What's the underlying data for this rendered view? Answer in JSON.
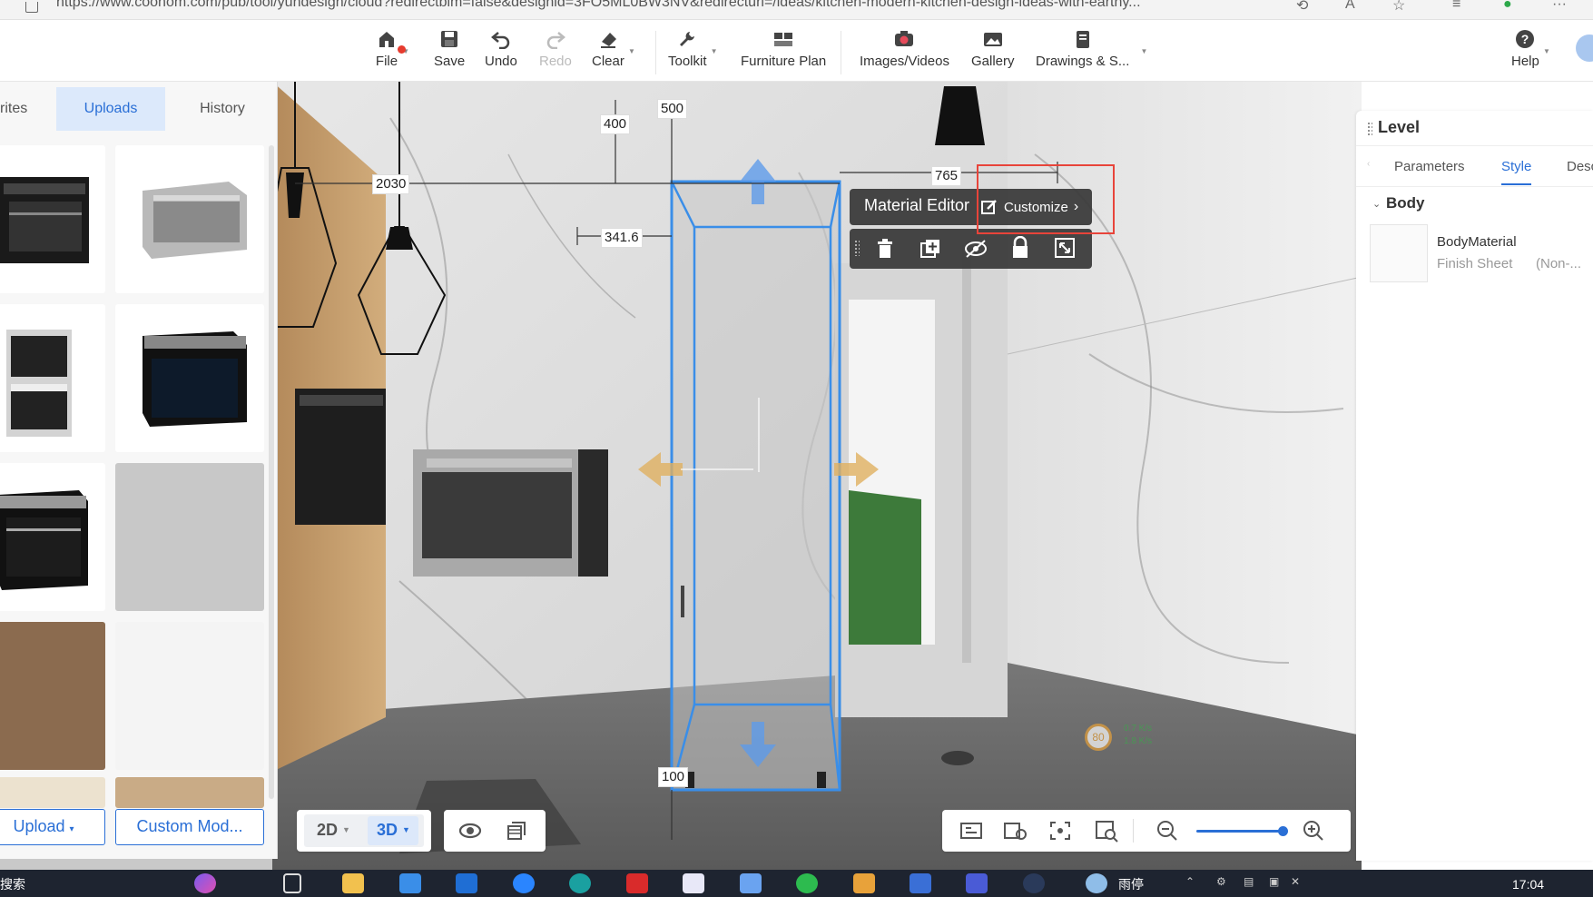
{
  "browser": {
    "url": "https://www.coohom.com/pub/tool/yundesign/cloud?redirectbim=false&designid=3FO5ML0BW3NV&redirecturl=/ideas/kitchen-modern-kitchen-design-ideas-with-earthy..."
  },
  "toolbar": {
    "file": "File",
    "save": "Save",
    "undo": "Undo",
    "redo": "Redo",
    "clear": "Clear",
    "toolkit": "Toolkit",
    "furniture_plan": "Furniture Plan",
    "images_videos": "Images/Videos",
    "gallery": "Gallery",
    "drawings": "Drawings & S...",
    "help": "Help"
  },
  "left_panel": {
    "tabs": [
      "rites",
      "Uploads",
      "History"
    ],
    "active_tab": "Uploads",
    "upload_button": "Upload",
    "custom_model_button": "Custom Mod..."
  },
  "view_controls": {
    "mode_2d": "2D",
    "mode_3d": "3D",
    "active_mode": "3D"
  },
  "dimensions": {
    "d400": "400",
    "d500": "500",
    "d2030": "2030",
    "d765": "765",
    "d341": "341.6",
    "d100": "100"
  },
  "context_menu": {
    "material_editor": "Material Editor",
    "customize": "Customize"
  },
  "net_stats": {
    "score": "80",
    "up": "0.7 K/s",
    "down": "1.8 K/s"
  },
  "right_panel": {
    "title": "Level",
    "tabs": [
      "Parameters",
      "Style",
      "Desc"
    ],
    "active_tab": "Style",
    "section": "Body",
    "material_name": "BodyMaterial",
    "material_sub": "Finish Sheet",
    "material_extra": "(Non-..."
  },
  "zoom": {
    "level": 0.95
  },
  "taskbar": {
    "search_text": "搜索",
    "weather": "雨停",
    "time": "17:04"
  },
  "colors": {
    "accent": "#2a6fd6",
    "highlight_box": "#e8443a",
    "selection": "#3a8ee8"
  }
}
